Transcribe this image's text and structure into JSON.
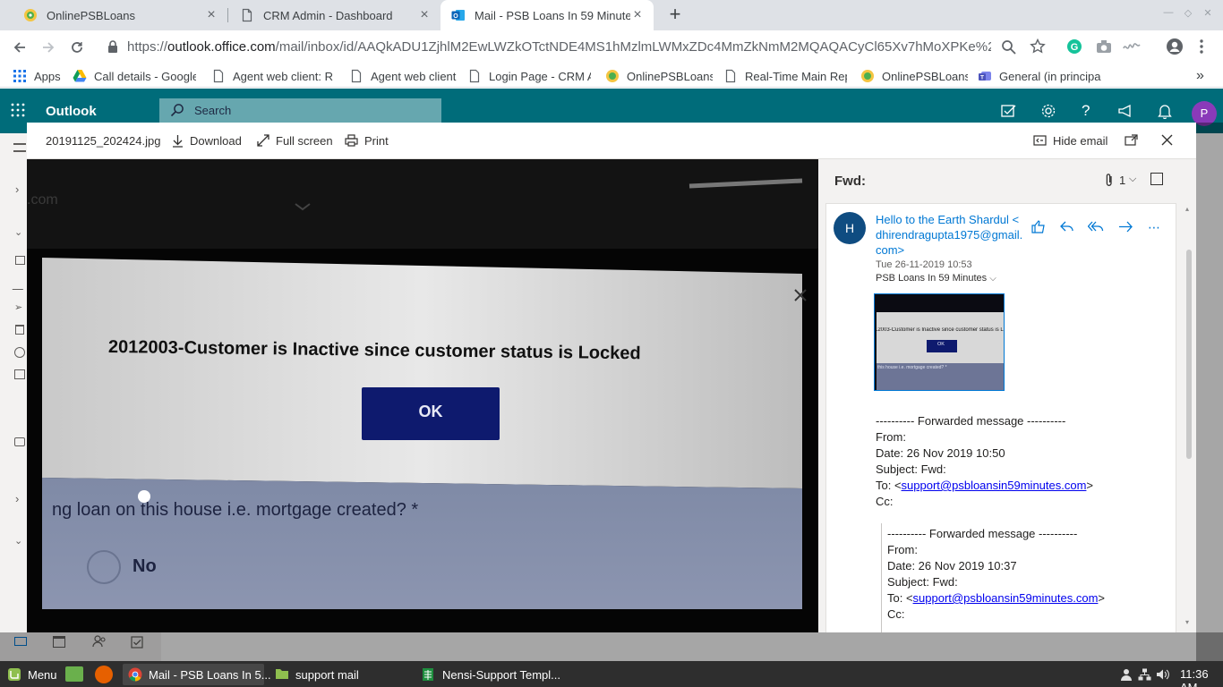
{
  "browser": {
    "tabs": [
      {
        "title": "OnlinePSBLoans",
        "icon": "psb-favicon",
        "active": false
      },
      {
        "title": "CRM Admin - Dashboard",
        "icon": "page-icon",
        "active": false
      },
      {
        "title": "Mail - PSB Loans In 59 Minutes",
        "icon": "outlook-icon",
        "active": true
      }
    ],
    "address": {
      "scheme": "https://",
      "host": "outlook.office.com",
      "path": "/mail/inbox/id/AAQkADU1ZjhlM2EwLWZkOTctNDE4MS1hMzlmLWMxZDc4MmZkNmM2MQAQACyCl65Xv7hMoXPKe%2..."
    },
    "bookmarks": [
      {
        "label": "Apps",
        "icon": "apps-grid-icon"
      },
      {
        "label": "Call details - Google...",
        "icon": "google-drive-icon"
      },
      {
        "label": "Agent web client: Re...",
        "icon": "page-icon"
      },
      {
        "label": "Agent web client",
        "icon": "page-icon"
      },
      {
        "label": "Login Page - CRM Ad...",
        "icon": "page-icon"
      },
      {
        "label": "OnlinePSBLoans",
        "icon": "psb-favicon"
      },
      {
        "label": "Real-Time Main Repo...",
        "icon": "page-icon"
      },
      {
        "label": "OnlinePSBLoans",
        "icon": "psb-favicon"
      },
      {
        "label": "General (in principal...",
        "icon": "teams-icon"
      }
    ],
    "more_bookmarks": "»"
  },
  "outlook": {
    "app_name": "Outlook",
    "search_placeholder": "Search",
    "avatar_initial": "P"
  },
  "viewer": {
    "filename": "20191125_202424.jpg",
    "download": "Download",
    "fullscreen": "Full screen",
    "print": "Print",
    "hide_email": "Hide email",
    "photo": {
      "error_text": "2012003-Customer is Inactive since customer status is Locked",
      "ok_label": "OK",
      "question_text": "ng loan on this house i.e. mortgage created? *",
      "option_no": "No",
      "top_fragment": ".com"
    }
  },
  "email": {
    "subject": "Fwd:",
    "attachment_count": "1",
    "sender_initial": "H",
    "sender_line1": "Hello to the Earth Shardul <",
    "sender_line2": "dhirendragupta1975@gmail.",
    "sender_line3": "com>",
    "date": "Tue 26-11-2019 10:53",
    "recipient": "PSB Loans In 59 Minutes",
    "thumb_text": "12003-Customer is Inactive since customer status is Lock",
    "thumb_ok": "OK",
    "thumb_question": "this house i.e. mortgage created? *",
    "forward1": {
      "header": "---------- Forwarded message ----------",
      "from": "From:",
      "date": "Date: 26 Nov 2019 10:50",
      "subject": "Subject: Fwd:",
      "to_prefix": "To: <",
      "to_email": "support@psbloansin59minutes.com",
      "to_suffix": ">",
      "cc": "Cc:"
    },
    "forward2": {
      "header": "---------- Forwarded message ----------",
      "from": "From:",
      "date": "Date: 26 Nov 2019 10:37",
      "subject": "Subject: Fwd:",
      "to_prefix": "To: <",
      "to_email": "support@psbloansin59minutes.com",
      "to_suffix": ">",
      "cc": "Cc:"
    }
  },
  "taskbar": {
    "menu": "Menu",
    "items": [
      {
        "label": "Mail - PSB Loans In 5...",
        "icon": "chrome-icon",
        "active": true
      },
      {
        "label": "support mail",
        "icon": "folder-icon",
        "active": false
      },
      {
        "label": "Nensi-Support Templ...",
        "icon": "spreadsheet-icon",
        "active": false
      }
    ],
    "clock": "11:36 AM"
  },
  "colors": {
    "outlook_header": "#006c7a",
    "outlook_link": "#0078d4",
    "ok_button": "#0e1a6e"
  }
}
